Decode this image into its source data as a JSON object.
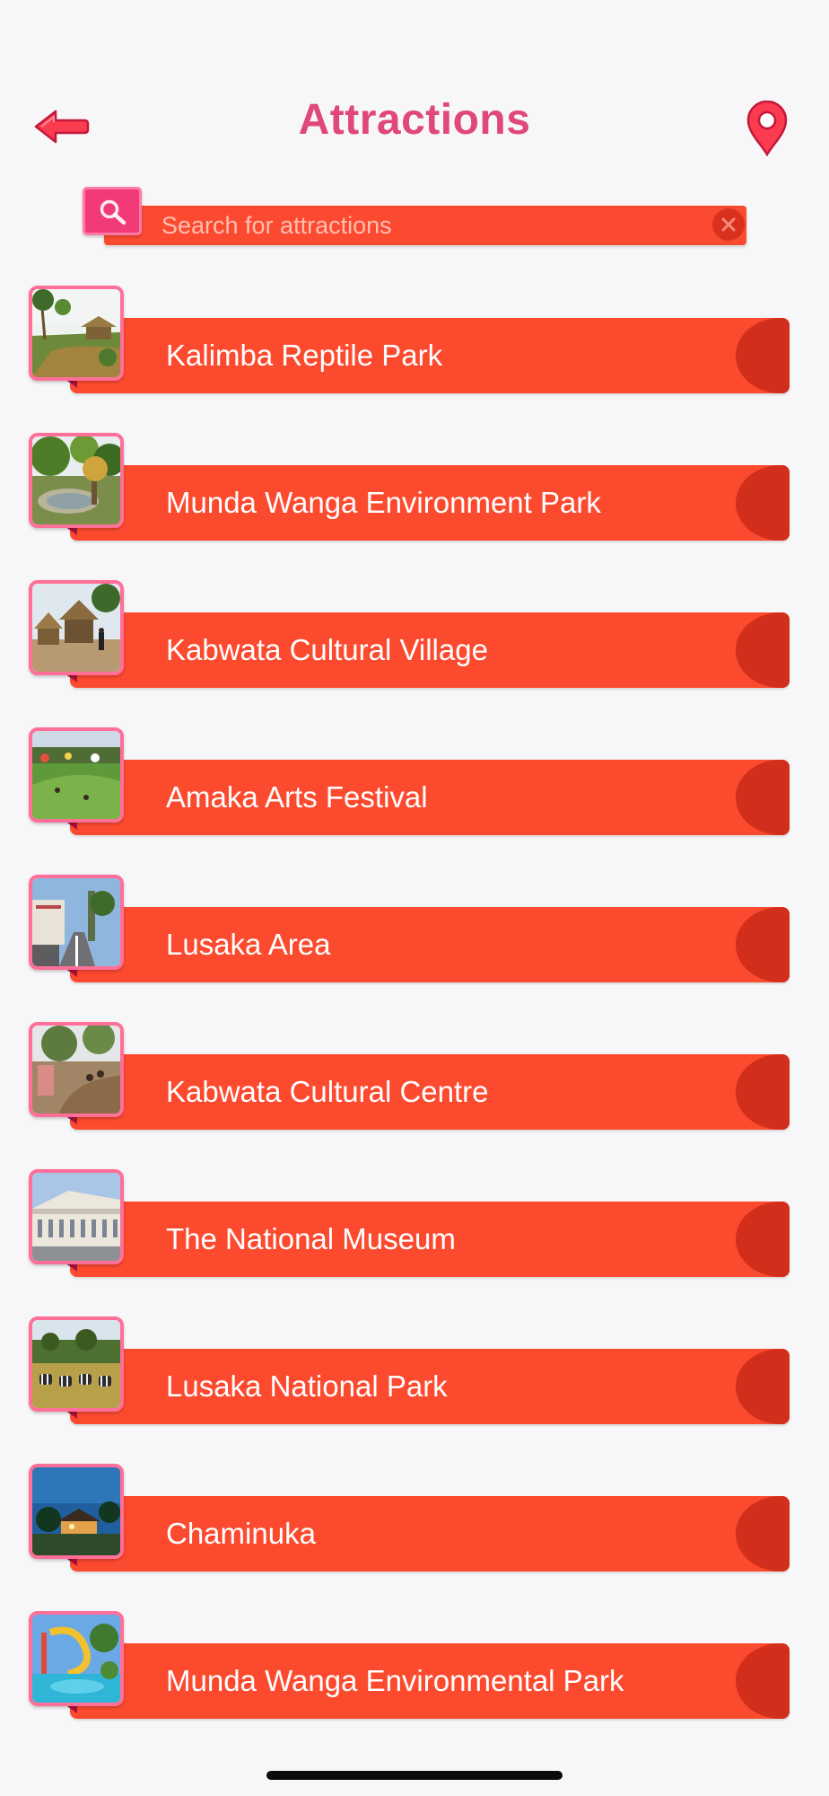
{
  "header": {
    "title": "Attractions",
    "back_icon": "back-arrow-icon",
    "map_icon": "map-pin-icon"
  },
  "search": {
    "placeholder": "Search for attractions",
    "value": "",
    "search_icon": "magnifier-icon",
    "clear_icon": "close-icon"
  },
  "attractions": [
    {
      "label": "Kalimba Reptile Park",
      "thumb": "garden-huts"
    },
    {
      "label": "Munda Wanga Environment Park",
      "thumb": "trees-pond"
    },
    {
      "label": "Kabwata Cultural Village",
      "thumb": "thatched-huts"
    },
    {
      "label": "Amaka Arts Festival",
      "thumb": "lawn-crowd"
    },
    {
      "label": "Lusaka Area",
      "thumb": "city-street"
    },
    {
      "label": "Kabwata Cultural Centre",
      "thumb": "dirt-path"
    },
    {
      "label": "The National Museum",
      "thumb": "museum-building"
    },
    {
      "label": "Lusaka National Park",
      "thumb": "zebras-savanna"
    },
    {
      "label": "Chaminuka",
      "thumb": "lodge-night"
    },
    {
      "label": "Munda Wanga Environmental Park",
      "thumb": "water-slide"
    }
  ],
  "colors": {
    "accent_pink": "#e0487a",
    "banner_red": "#fc4a2f",
    "knob_red": "#d22e1c",
    "thumb_border": "#ff6f98",
    "background": "#f7f7f9"
  }
}
